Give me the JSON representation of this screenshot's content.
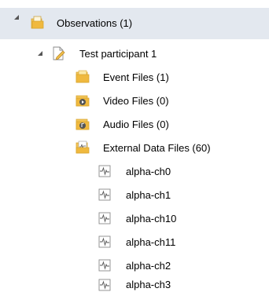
{
  "tree": {
    "root": {
      "label": "Observations (1)",
      "icon": "book-folder-icon",
      "expanded": true,
      "selected": true
    },
    "participant": {
      "label": "Test participant 1",
      "icon": "edit-document-icon",
      "expanded": true
    },
    "folders": [
      {
        "label": "Event Files (1)",
        "icon": "folder-icon"
      },
      {
        "label": "Video Files (0)",
        "icon": "video-folder-icon"
      },
      {
        "label": "Audio Files (0)",
        "icon": "audio-folder-icon"
      },
      {
        "label": "External Data Files (60)",
        "icon": "data-folder-icon"
      }
    ],
    "data_files": [
      {
        "label": "alpha-ch0",
        "icon": "signal-file-icon"
      },
      {
        "label": "alpha-ch1",
        "icon": "signal-file-icon"
      },
      {
        "label": "alpha-ch10",
        "icon": "signal-file-icon"
      },
      {
        "label": "alpha-ch11",
        "icon": "signal-file-icon"
      },
      {
        "label": "alpha-ch2",
        "icon": "signal-file-icon"
      },
      {
        "label": "alpha-ch3",
        "icon": "signal-file-icon"
      }
    ]
  },
  "colors": {
    "selection_bg": "#e3e8ef",
    "folder_yellow": "#f4c659",
    "folder_dark": "#d9a630"
  }
}
